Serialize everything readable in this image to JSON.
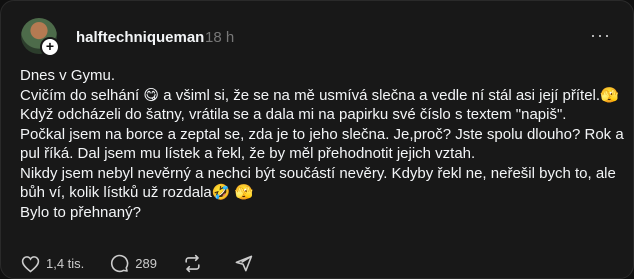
{
  "post": {
    "username": "halftechniqueman",
    "time": "18 h",
    "lines": [
      "Dnes v Gymu.",
      "Cvičím do selhání 😋  a všiml si, že se na mě usmívá slečna a vedle ní stál asi její přítel.🫣",
      "Když odcházeli do šatny, vrátila se a dala mi na papirku své číslo s textem \"napiš\".",
      "Počkal jsem na borce a zeptal se, zda je to jeho slečna. Je,proč? Jste spolu dlouho? Rok a",
      "pul říká. Dal jsem mu lístek a řekl, že by měl přehodnotit jejich vztah.",
      "Nikdy jsem nebyl nevěrný a nechci být součástí nevěry. Kdyby řekl ne, neřešil bych to, ale",
      "bůh ví, kolik lístků už rozdala🤣 🫣",
      "Bylo to přehnaný?"
    ],
    "likes": "1,4 tis.",
    "comments": "289",
    "more_label": "···",
    "follow_label": "+"
  },
  "icons": {
    "like": "heart-icon",
    "comment": "comment-bubble-icon",
    "repost": "repost-icon",
    "share": "share-send-icon",
    "more": "more-dots-icon"
  }
}
